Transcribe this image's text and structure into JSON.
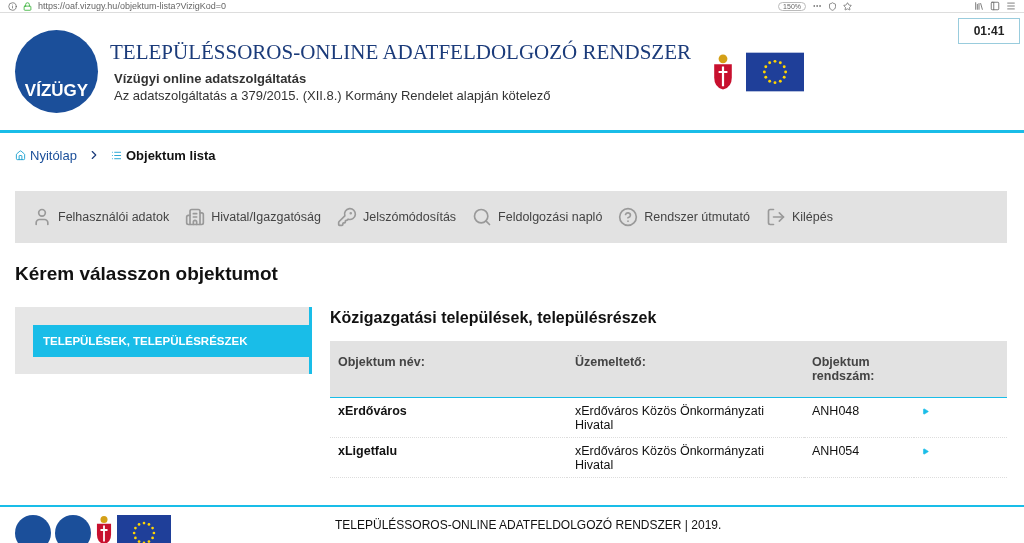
{
  "browser": {
    "url": "https://oaf.vizugy.hu/objektum-lista?VizigKod=0",
    "zoom": "150%",
    "timer": "01:41"
  },
  "header": {
    "logo_text": "VÍZÜGY",
    "title": "TELEPÜLÉSSOROS-ONLINE ADATFELDOLGOZÓ RENDSZER",
    "subtitle": "Vízügyi online adatszolgáltatás",
    "note": "Az adatszolgáltatás a 379/2015. (XII.8.) Kormány Rendelet alapján kötelező"
  },
  "breadcrumb": [
    {
      "label": "Nyitólap",
      "kind": "home"
    },
    {
      "label": "Objektum lista",
      "kind": "list"
    }
  ],
  "menu": [
    {
      "label": "Felhasználói adatok",
      "kind": "user"
    },
    {
      "label": "Hivatal/Igazgatóság",
      "kind": "building"
    },
    {
      "label": "Jelszómódosítás",
      "kind": "key"
    },
    {
      "label": "Feldolgozási napló",
      "kind": "search"
    },
    {
      "label": "Rendszer útmutató",
      "kind": "help"
    },
    {
      "label": "Kilépés",
      "kind": "exit"
    }
  ],
  "heading": "Kérem válasszon objektumot",
  "sidebar": {
    "items": [
      {
        "label": "TELEPÜLÉSEK, TELEPÜLÉSRÉSZEK",
        "selected": true
      }
    ]
  },
  "section_title": "Közigazgatási települések, településrészek",
  "table": {
    "columns": [
      "Objektum név:",
      "Üzemeltető:",
      "Objektum rendszám:"
    ],
    "rows": [
      [
        "xErdőváros",
        "xErdőváros Közös Önkormányzati Hivatal",
        "ANH048"
      ],
      [
        "xLigetfalu",
        "xErdőváros Közös Önkormányzati Hivatal",
        "ANH054"
      ]
    ]
  },
  "footer": "TELEPÜLÉSSOROS-ONLINE ADATFELDOLGOZÓ RENDSZER | 2019."
}
